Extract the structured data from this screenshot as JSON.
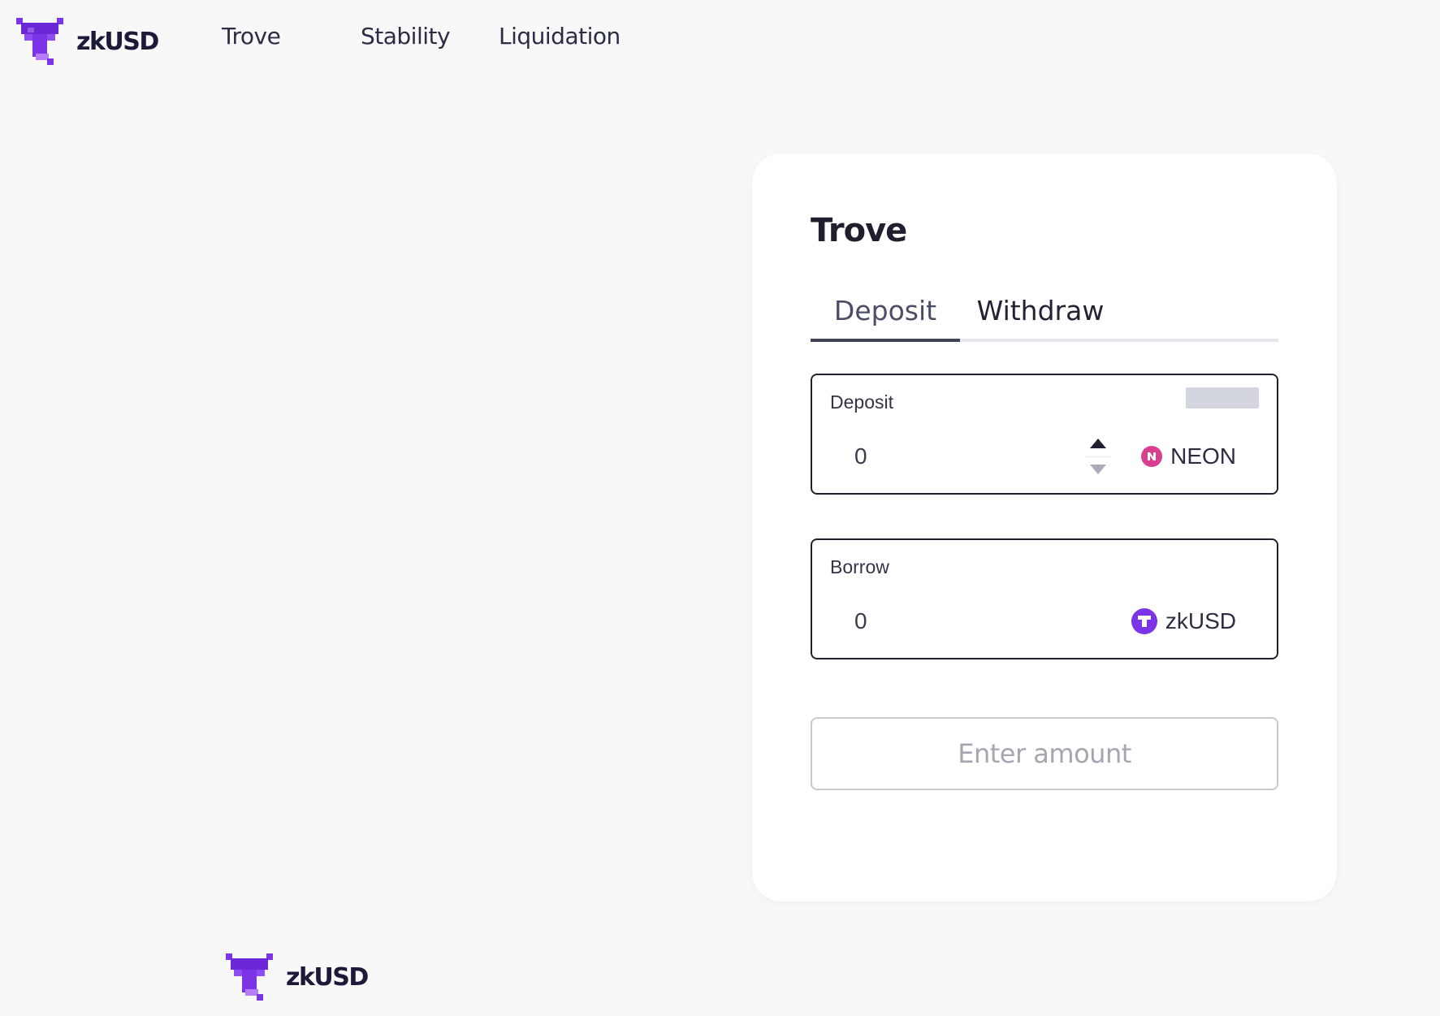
{
  "header": {
    "brand": "zkUSD",
    "nav": {
      "trove": "Trove",
      "stability": "Stability",
      "liquidation": "Liquidation"
    }
  },
  "card": {
    "title": "Trove",
    "tabs": {
      "deposit": "Deposit",
      "withdraw": "Withdraw",
      "active": "Deposit"
    },
    "deposit_field": {
      "label": "Deposit",
      "value": "0",
      "token": "NEON",
      "token_icon": "neon-token-icon"
    },
    "borrow_field": {
      "label": "Borrow",
      "value": "0",
      "token": "zkUSD",
      "token_icon": "zkusd-token-icon"
    },
    "submit_label": "Enter amount"
  },
  "footer": {
    "brand": "zkUSD"
  },
  "colors": {
    "brand_purple": "#7b34e6",
    "neon_pink": "#d8408f",
    "text_dark": "#1b1a38"
  }
}
